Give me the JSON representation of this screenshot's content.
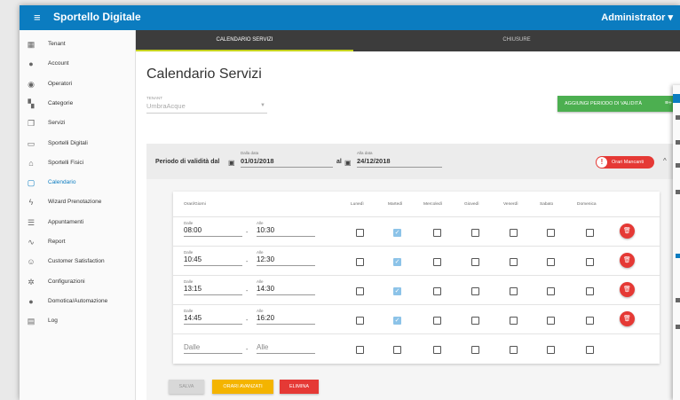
{
  "app": {
    "menu_icon": "≡",
    "title": "Sportello Digitale",
    "user": "Administrator ▾"
  },
  "sidebar": {
    "items": [
      {
        "label": "Tenant",
        "icon": "building-icon",
        "glyph": "▦"
      },
      {
        "label": "Account",
        "icon": "person-icon",
        "glyph": "●"
      },
      {
        "label": "Operatori",
        "icon": "account-circle-icon",
        "glyph": "◉"
      },
      {
        "label": "Categorie",
        "icon": "dashboard-icon",
        "glyph": "▚"
      },
      {
        "label": "Servizi",
        "icon": "copy-icon",
        "glyph": "❐"
      },
      {
        "label": "Sportelli Digitali",
        "icon": "monitor-icon",
        "glyph": "▭"
      },
      {
        "label": "Sportelli Fisici",
        "icon": "home-icon",
        "glyph": "⌂"
      },
      {
        "label": "Calendario",
        "icon": "calendar-icon",
        "glyph": "▢",
        "active": true
      },
      {
        "label": "Wizard Prenotazione",
        "icon": "flash-icon",
        "glyph": "ϟ"
      },
      {
        "label": "Appuntamenti",
        "icon": "list-icon",
        "glyph": "☰"
      },
      {
        "label": "Report",
        "icon": "trending-icon",
        "glyph": "∿"
      },
      {
        "label": "Customer Satisfaction",
        "icon": "smiley-icon",
        "glyph": "☺"
      },
      {
        "label": "Configurazioni",
        "icon": "gear-icon",
        "glyph": "✲"
      },
      {
        "label": "Domotica/Automazione",
        "icon": "automation-icon",
        "glyph": "●"
      },
      {
        "label": "Log",
        "icon": "clipboard-icon",
        "glyph": "▤"
      }
    ]
  },
  "tabs": [
    "CALENDARIO SERVIZI",
    "CHIUSURE"
  ],
  "page": {
    "title": "Calendario Servizi",
    "tenant_label": "TENANT",
    "tenant_value": "UmbraAcque",
    "add_button": "AGGIUNGI PERIODO DI VALIDITÀ"
  },
  "period": {
    "label": "Periodo di validità dal",
    "from_label": "Dalla data",
    "from_value": "01/01/2018",
    "al": "al",
    "to_label": "Alla data",
    "to_value": "24/12/2018",
    "badge": "Orari Mancanti"
  },
  "table": {
    "headers": [
      "Orari/Giorni",
      "Lunedì",
      "Martedì",
      "Mercoledì",
      "Giovedì",
      "Venerdì",
      "Sabato",
      "Domenica"
    ],
    "from_label": "Dalle",
    "to_label": "Alle",
    "rows": [
      {
        "from": "08:00",
        "to": "10:30",
        "checked": [
          false,
          true,
          false,
          false,
          false,
          false,
          false
        ]
      },
      {
        "from": "10:45",
        "to": "12:30",
        "checked": [
          false,
          true,
          false,
          false,
          false,
          false,
          false
        ]
      },
      {
        "from": "13:15",
        "to": "14:30",
        "checked": [
          false,
          true,
          false,
          false,
          false,
          false,
          false
        ]
      },
      {
        "from": "14:45",
        "to": "16:20",
        "checked": [
          false,
          true,
          false,
          false,
          false,
          false,
          false
        ]
      }
    ],
    "new_row": {
      "from_placeholder": "Dalle",
      "to_placeholder": "Alle"
    }
  },
  "actions": {
    "save": "SALVA",
    "advanced": "ORARI AVANZATI",
    "delete": "ELIMINA"
  },
  "colors": {
    "primary": "#0b7cc0",
    "success": "#4caf50",
    "danger": "#e53935",
    "warning": "#f4b400"
  }
}
